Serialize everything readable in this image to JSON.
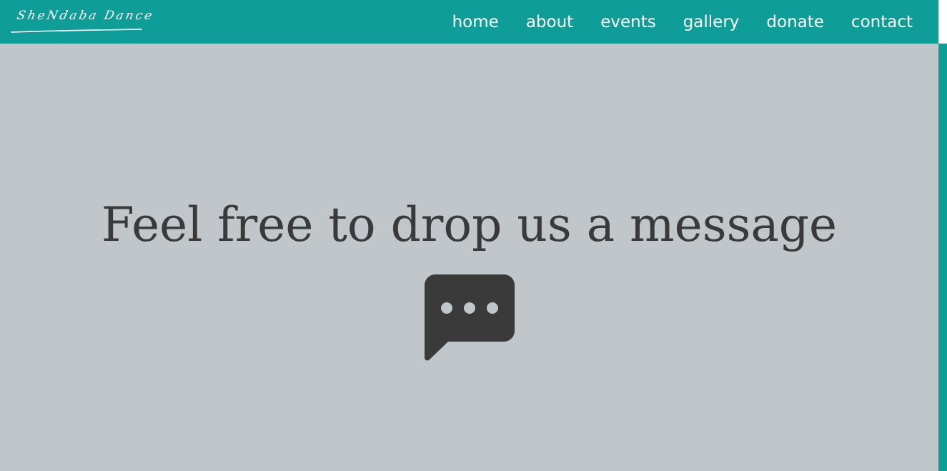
{
  "brand": {
    "logo_text": "SheNdaba Dance",
    "logo_icon": "script-signature-logo"
  },
  "nav": {
    "items": [
      {
        "label": "home"
      },
      {
        "label": "about"
      },
      {
        "label": "events"
      },
      {
        "label": "gallery"
      },
      {
        "label": "donate"
      },
      {
        "label": "contact"
      }
    ]
  },
  "hero": {
    "headline": "Feel free to drop us a message",
    "icon": "chat-bubble-icon"
  },
  "colors": {
    "accent": "#0e9e97",
    "background": "#c1c6ca",
    "text": "#3a3a3b",
    "nav_text": "#ffffff"
  }
}
